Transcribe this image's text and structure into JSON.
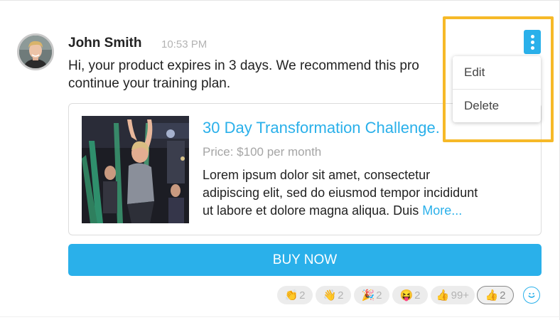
{
  "message": {
    "author": "John Smith",
    "time": "10:53 PM",
    "text_line1": "Hi, your product expires in 3 days. We recommend this pro",
    "text_line2": "continue your training plan."
  },
  "product_card": {
    "title": "30 Day Transformation Challenge.",
    "price": "Price: $100 per month",
    "desc_line1": "Lorem ipsum dolor sit amet, consectetur",
    "desc_line2": "adipiscing elit, sed do eiusmod tempor incididunt",
    "desc_line3": "ut labore et dolore magna aliqua. Duis ",
    "more_link": "More...",
    "image_icon": "fitness-class-photo"
  },
  "buy_button": {
    "label": "BUY NOW"
  },
  "reactions": [
    {
      "emoji": "👏",
      "count": "2",
      "icon": "clap-icon"
    },
    {
      "emoji": "👋",
      "count": "2",
      "icon": "wave-icon"
    },
    {
      "emoji": "🎉",
      "count": "2",
      "icon": "party-icon"
    },
    {
      "emoji": "😝",
      "count": "2",
      "icon": "tongue-face-icon"
    },
    {
      "emoji": "👍",
      "count": "99+",
      "icon": "thumbs-up-icon"
    },
    {
      "emoji": "👍",
      "count": "2",
      "icon": "thumbs-up-icon"
    }
  ],
  "add_reaction_icon": "smiley-add-icon",
  "menu": {
    "icon": "kebab-menu-icon",
    "items": [
      {
        "label": "Edit"
      },
      {
        "label": "Delete"
      }
    ]
  },
  "colors": {
    "accent": "#2ab0ea",
    "highlight": "#f6b928",
    "text": "#222222",
    "muted": "#b3b3b3"
  }
}
